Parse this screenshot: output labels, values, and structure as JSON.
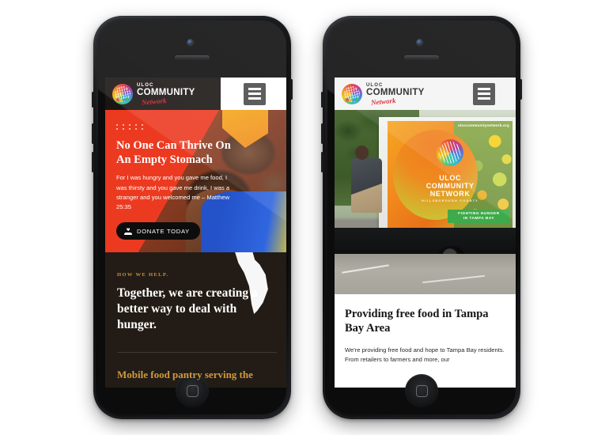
{
  "scene": {
    "background_color": "#ffffff",
    "device_count": 2
  },
  "brand": {
    "logo_uloc": "ULOC",
    "logo_community": "COMMUNITY",
    "logo_network": "Network",
    "accent_red": "#ec3a21",
    "accent_gold": "#c8923a",
    "dark_brown": "#231c16"
  },
  "phone_left": {
    "header": {
      "menu_icon": "hamburger-icon"
    },
    "hero": {
      "title": "No One Can Thrive On An Empty Stomach",
      "body": "For I was hungry and you gave me food, I was thirsty and you gave me drink, I was a stranger and you welcomed me – Matthew 25:35",
      "cta_label": "DONATE TODAY",
      "cta_icon": "donation-hand-heart-icon",
      "dot_count": 10
    },
    "help": {
      "eyebrow": "HOW WE HELP.",
      "title": "Together, we are creating a better way to deal with hunger.",
      "subtitle": "Mobile food pantry serving the",
      "map_icon": "florida-map-silhouette"
    }
  },
  "phone_right": {
    "header": {
      "menu_icon": "hamburger-icon"
    },
    "billboard": {
      "url": "uloccommunitynetwork.org",
      "line1": "ULOC",
      "line2": "COMMUNITY",
      "line3": "NETWORK",
      "line4": "HILLSBOROUGH COUNTY",
      "band_line1": "FIGHTING HUNGER",
      "band_line2": "IN TAMPA BAY",
      "band_color": "#3faa4a"
    },
    "article": {
      "title": "Providing free food in Tampa Bay Area",
      "body": "We're providing free food and hope to Tampa Bay residents. From retailers to farmers and more, our"
    }
  }
}
